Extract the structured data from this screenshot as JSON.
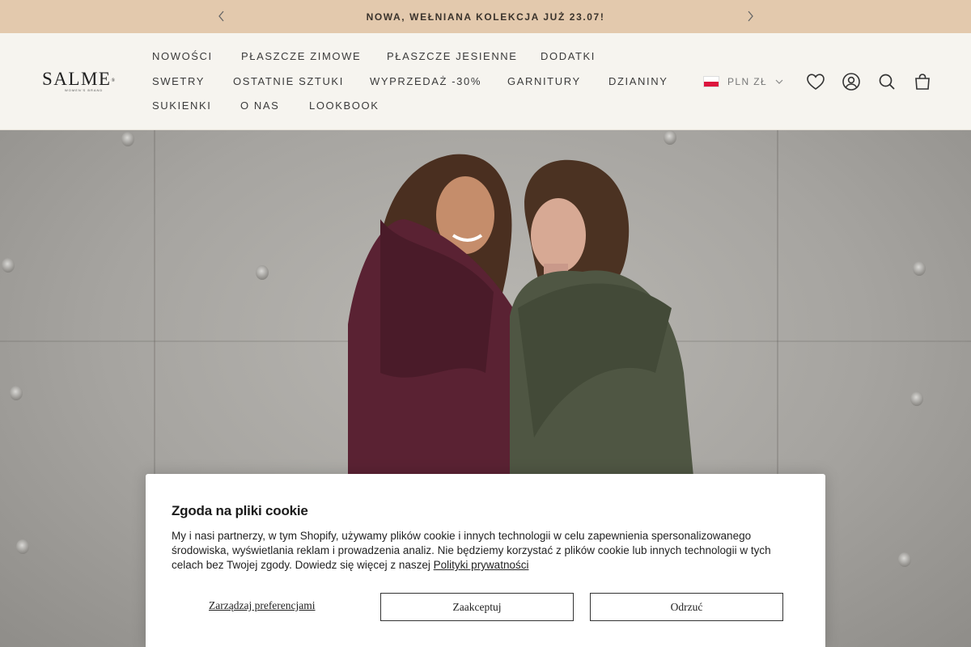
{
  "announcement": {
    "text": "NOWA, WEŁNIANA KOLEKCJA JUŻ 23.07!",
    "prev_icon": "chevron-left-icon",
    "next_icon": "chevron-right-icon"
  },
  "header": {
    "logo": {
      "brand": "SALME",
      "tagline": "WOMEN'S BRAND"
    },
    "nav": [
      "NOWOŚCI",
      "PŁASZCZE ZIMOWE",
      "PŁASZCZE JESIENNE",
      "DODATKI",
      "SWETRY",
      "OSTATNIE SZTUKI",
      "WYPRZEDAŻ -30%",
      "GARNITURY",
      "DZIANINY",
      "SUKIENKI",
      "O NAS",
      "LOOKBOOK"
    ],
    "currency": {
      "label": "PLN ZŁ",
      "flag": "poland-flag-icon"
    },
    "icons": [
      "heart-icon",
      "account-icon",
      "search-icon",
      "bag-icon"
    ]
  },
  "cookie": {
    "title": "Zgoda na pliki cookie",
    "body": "My i nasi partnerzy, w tym Shopify, używamy plików cookie i innych technologii w celu zapewnienia spersonalizowanego środowiska, wyświetlania reklam i prowadzenia analiz. Nie będziemy korzystać z plików cookie lub innych technologii w tych celach bez Twojej zgody. Dowiedz się więcej z naszej ",
    "link": "Polityki prywatności",
    "manage_label": "Zarządzaj preferencjami",
    "accept_label": "Zaakceptuj",
    "reject_label": "Odrzuć"
  },
  "colors": {
    "announcement_bg": "#e3c9ad",
    "header_bg": "#f6f4ef",
    "burgundy_coat": "#5a2233",
    "olive_coat": "#4f5643"
  }
}
